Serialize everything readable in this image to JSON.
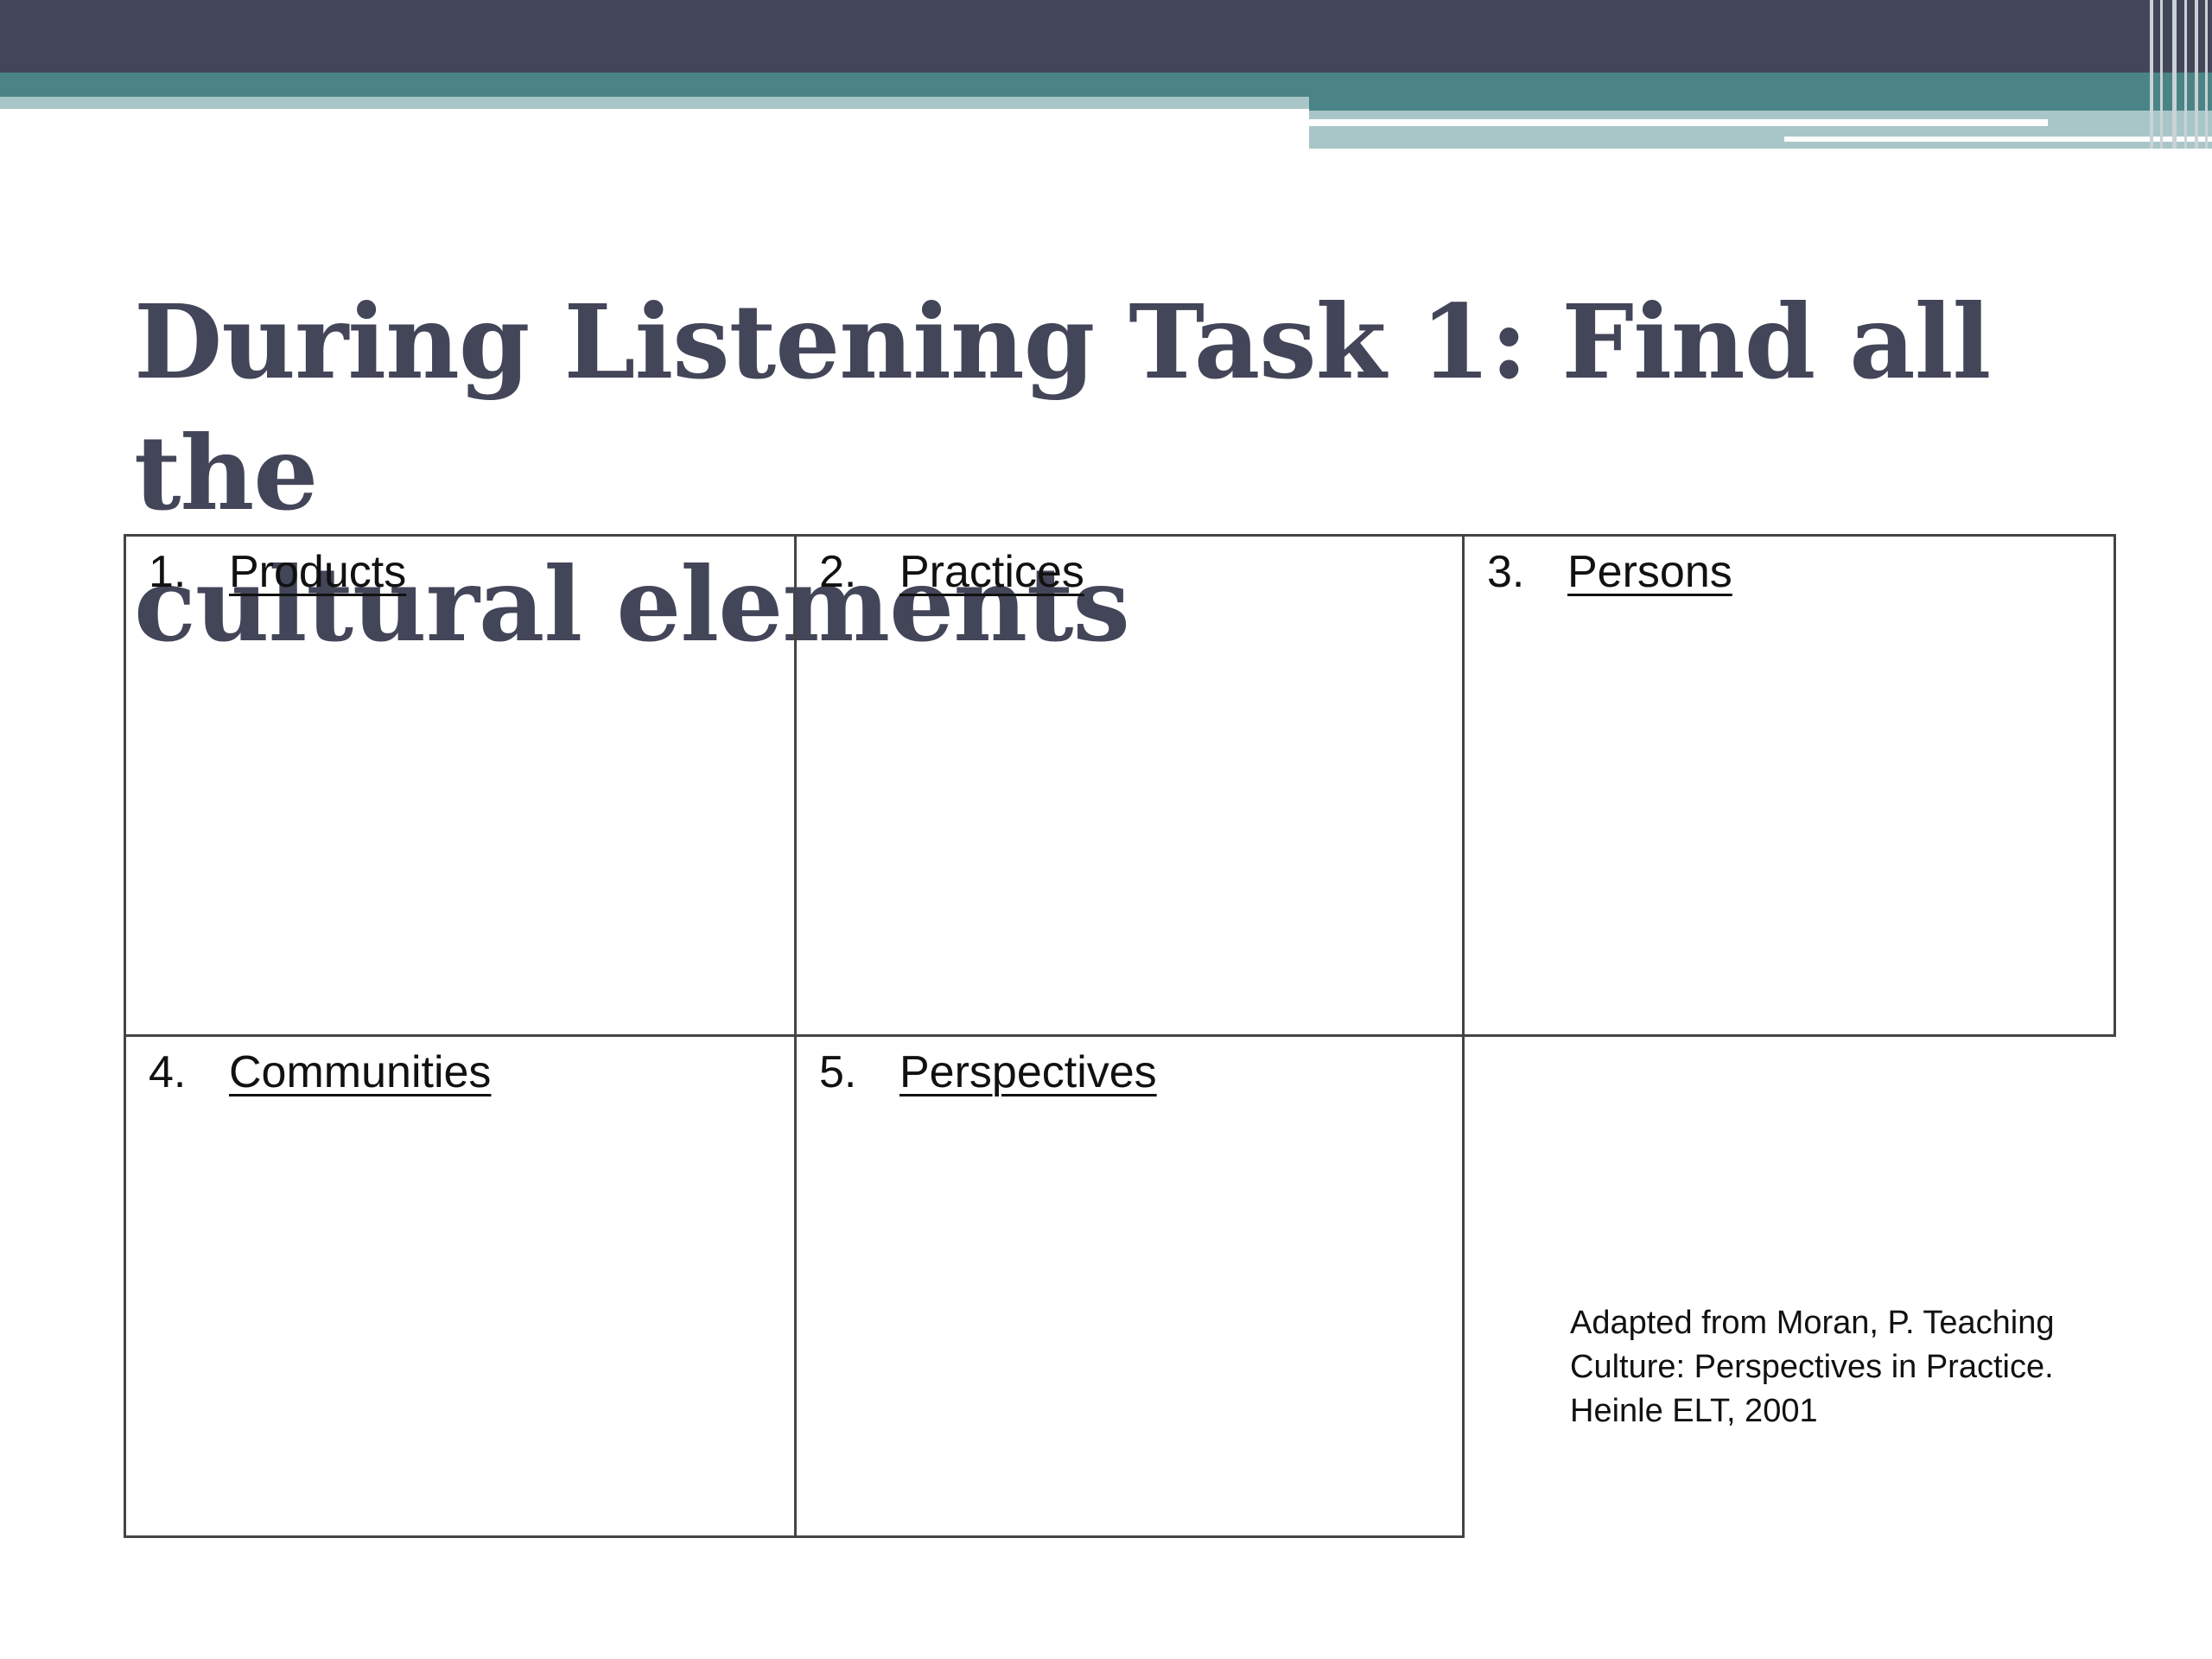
{
  "slide": {
    "title_line1": "During Listening Task 1: Find all the",
    "title_line2": "cultural elements",
    "colors": {
      "header_dark": "#434559",
      "header_teal": "#4a8487",
      "header_light": "#a8c6c7",
      "title": "#434559"
    }
  },
  "table": {
    "cells": [
      {
        "number": "1.",
        "label": "Products"
      },
      {
        "number": "2.",
        "label": "Practices"
      },
      {
        "number": "3.",
        "label": "Persons"
      },
      {
        "number": "4.",
        "label": "Communities"
      },
      {
        "number": "5.",
        "label": "Perspectives"
      }
    ]
  },
  "citation": {
    "line1": "Adapted from Moran, P.  Teaching",
    "line2": "Culture: Perspectives in Practice.",
    "line3": "Heinle ELT, 2001"
  }
}
